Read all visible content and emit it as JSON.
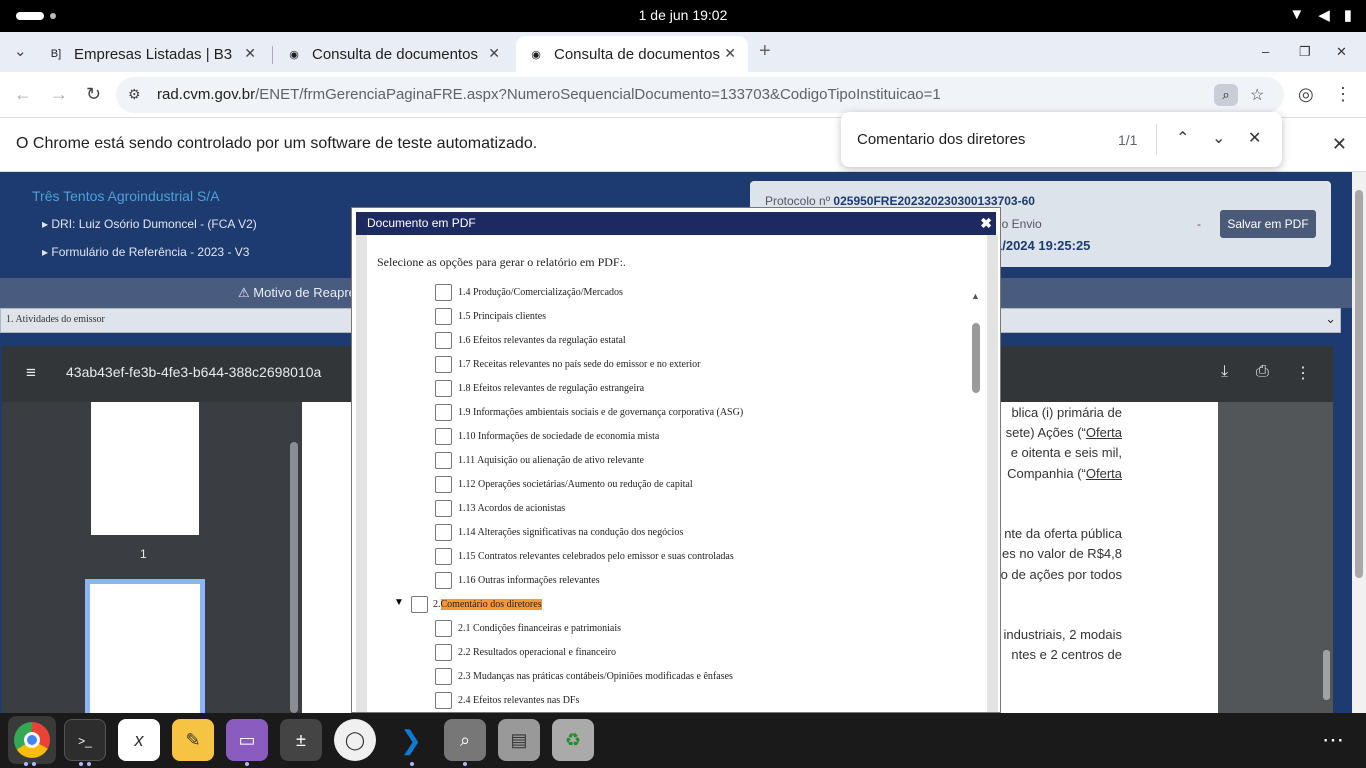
{
  "system_bar": {
    "date_time": "1 de jun  19:02",
    "wifi_icon": "▼",
    "volume_icon": "◀",
    "battery_icon": "▮"
  },
  "tabs": [
    {
      "title": "Empresas Listadas | B3",
      "favicon": "B]"
    },
    {
      "title": "Consulta de documentos",
      "favicon": "◉"
    },
    {
      "title": "Consulta de documentos",
      "favicon": "◉"
    }
  ],
  "tab_close_glyph": "✕",
  "new_tab_glyph": "+",
  "window_controls": {
    "minimize": "–",
    "maximize": "❐",
    "close": "✕"
  },
  "address": {
    "url_host": "rad.cvm.gov.br",
    "url_path": "/ENET/frmGerenciaPaginaFRE.aspx?NumeroSequencialDocumento=133703&CodigoTipoInstituicao=1"
  },
  "infobar": {
    "text": "O Chrome está sendo controlado por um software de teste automatizado.",
    "close": "✕"
  },
  "find": {
    "query": "Comentario dos diretores",
    "count": "1/1",
    "prev": "⌃",
    "next": "⌄",
    "close": "✕"
  },
  "header": {
    "company": "Três Tentos Agroindustrial S/A",
    "dri": "▸ DRI:  Luiz Osório Dumoncel - (FCA V2)",
    "form": "▸ Formulário de Referência - 2023 - V3",
    "protocol_label": "Protocolo nº ",
    "protocol_value": "025950FRE202320230300133703-60",
    "envio_label": "do Envio",
    "dash": "-",
    "envio_date": "1/2024 19:25:25",
    "save_pdf": "Salvar em PDF",
    "reason": "⚠ Motivo de Reapre",
    "select_value": "1. Atividades do emissor",
    "select_chevron": "⌄"
  },
  "pdf_viewer": {
    "menu_icon": "≡",
    "file_name": "43ab43ef-fe3b-4fe3-b644-388c2698010a",
    "download_icon": "⤓",
    "print_icon": "⎙",
    "more_icon": "⋮",
    "thumb_page_label": "1",
    "text_lines": [
      {
        "text": "blica (i) primária de",
        "underline": ""
      },
      {
        "text": "sete) Ações (“",
        "underline": "Oferta"
      },
      {
        "text": "e oitenta e seis mil,",
        "underline": ""
      },
      {
        "text": "Companhia (“",
        "underline": "Oferta"
      },
      {
        "text": "nte da oferta pública",
        "underline": ""
      },
      {
        "text": "es no valor de R$4,8",
        "underline": ""
      },
      {
        "text": "o de ações por todos",
        "underline": ""
      },
      {
        "text": "industriais, 2 modais",
        "underline": ""
      },
      {
        "text": "ntes e 2 centros de",
        "underline": ""
      }
    ]
  },
  "modal": {
    "title": "Documento em PDF",
    "close": "✖",
    "subtitle": "Selecione as opções para gerar o relatório em PDF:.",
    "scroll_up": "▲",
    "options": [
      "1.4 Produção/Comercialização/Mercados",
      "1.5 Principais clientes",
      "1.6 Efeitos relevantes da regulação estatal",
      "1.7 Receitas relevantes no país sede do emissor e no exterior",
      "1.8 Efeitos relevantes de regulação estrangeira",
      "1.9 Informações ambientais sociais e de governança corporativa (ASG)",
      "1.10 Informações de sociedade de economia mista",
      "1.11 Aquisição ou alienação de ativo relevante",
      "1.12 Operações societárias/Aumento ou redução de capital",
      "1.13 Acordos de acionistas",
      "1.14 Alterações significativas na condução dos negócios",
      "1.15 Contratos relevantes celebrados pelo emissor e suas controladas",
      "1.16 Outras informações relevantes"
    ],
    "section": {
      "caret": "▼",
      "number": "2. ",
      "title": "Comentário dos diretores"
    },
    "sub_options": [
      "2.1 Condições financeiras e patrimoniais",
      "2.2 Resultados operacional e financeiro",
      "2.3 Mudanças nas práticas contábeis/Opiniões modificadas e ênfases",
      "2.4 Efeitos relevantes nas DFs"
    ]
  },
  "dock": [
    {
      "name": "Chrome",
      "glyph": "◉",
      "color": "#ea4335"
    },
    {
      "name": "Terminal",
      "glyph": ">_",
      "color": "#2d2d2d"
    },
    {
      "name": "Xournal",
      "glyph": "x",
      "color": "#ffffff"
    },
    {
      "name": "Text Editor",
      "glyph": "✎",
      "color": "#f6c343"
    },
    {
      "name": "Files",
      "glyph": "▭",
      "color": "#8a5cc0"
    },
    {
      "name": "Calculator",
      "glyph": "±",
      "color": "#444"
    },
    {
      "name": "Egg",
      "glyph": "◯",
      "color": "#f0f0f0"
    },
    {
      "name": "VS Code",
      "glyph": "❯",
      "color": "#0e7bd3"
    },
    {
      "name": "Image Viewer",
      "glyph": "⌕",
      "color": "#777"
    },
    {
      "name": "Disks",
      "glyph": "▤",
      "color": "#999"
    },
    {
      "name": "Trash",
      "glyph": "♻",
      "color": "#aaa"
    }
  ],
  "apps_grid_icon": "⋯"
}
